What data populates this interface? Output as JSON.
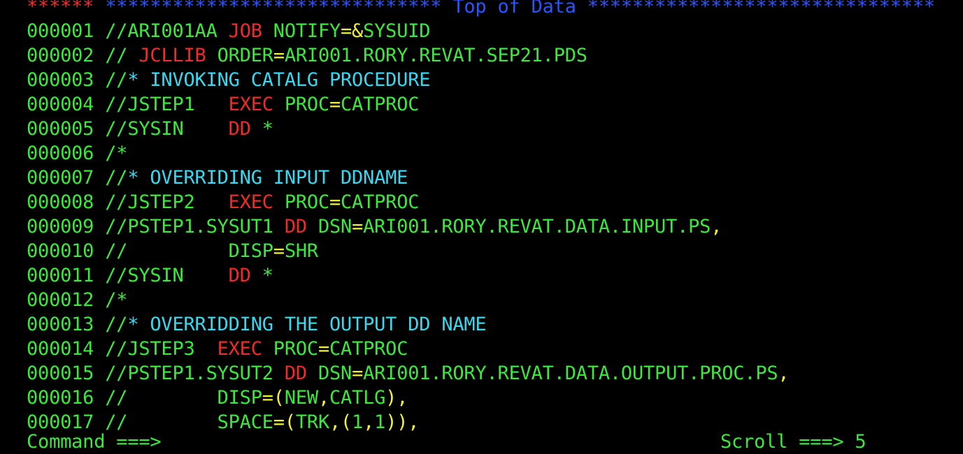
{
  "colors": {
    "green": "#3ce83c",
    "red": "#f22a2a",
    "blue": "#2a54ff",
    "yellow": "#f2f23a",
    "cyan": "#38d8f0"
  },
  "header": {
    "marker": "******",
    "stars_left": " ******************************",
    "title": " Top of Data ",
    "stars_right": "*******************************"
  },
  "lines": [
    {
      "num": "000001",
      "segs": [
        {
          "t": " //ARI001AA ",
          "c": "green"
        },
        {
          "t": "JOB",
          "c": "red"
        },
        {
          "t": " NOTIFY",
          "c": "green"
        },
        {
          "t": "=&",
          "c": "yellow"
        },
        {
          "t": "SYSUID",
          "c": "green"
        }
      ]
    },
    {
      "num": "000002",
      "segs": [
        {
          "t": " // ",
          "c": "green"
        },
        {
          "t": "JCLLIB",
          "c": "red"
        },
        {
          "t": " ORDER",
          "c": "green"
        },
        {
          "t": "=",
          "c": "yellow"
        },
        {
          "t": "ARI001.RORY.REVAT.SEP21.PDS",
          "c": "green"
        }
      ]
    },
    {
      "num": "000003",
      "segs": [
        {
          "t": " //",
          "c": "green"
        },
        {
          "t": "* INVOKING CATALG PROCEDURE",
          "c": "cyan"
        }
      ]
    },
    {
      "num": "000004",
      "segs": [
        {
          "t": " //JSTEP1   ",
          "c": "green"
        },
        {
          "t": "EXEC",
          "c": "red"
        },
        {
          "t": " PROC",
          "c": "green"
        },
        {
          "t": "=",
          "c": "yellow"
        },
        {
          "t": "CATPROC",
          "c": "green"
        }
      ]
    },
    {
      "num": "000005",
      "segs": [
        {
          "t": " //SYSIN    ",
          "c": "green"
        },
        {
          "t": "DD",
          "c": "red"
        },
        {
          "t": " *",
          "c": "green"
        }
      ]
    },
    {
      "num": "000006",
      "segs": [
        {
          "t": " /*",
          "c": "green"
        }
      ]
    },
    {
      "num": "000007",
      "segs": [
        {
          "t": " //",
          "c": "green"
        },
        {
          "t": "* OVERRIDING INPUT DDNAME",
          "c": "cyan"
        }
      ]
    },
    {
      "num": "000008",
      "segs": [
        {
          "t": " //JSTEP2   ",
          "c": "green"
        },
        {
          "t": "EXEC",
          "c": "red"
        },
        {
          "t": " PROC",
          "c": "green"
        },
        {
          "t": "=",
          "c": "yellow"
        },
        {
          "t": "CATPROC",
          "c": "green"
        }
      ]
    },
    {
      "num": "000009",
      "segs": [
        {
          "t": " //PSTEP1.SYSUT1 ",
          "c": "green"
        },
        {
          "t": "DD",
          "c": "red"
        },
        {
          "t": " DSN",
          "c": "green"
        },
        {
          "t": "=",
          "c": "yellow"
        },
        {
          "t": "ARI001.RORY.REVAT.DATA.INPUT.PS",
          "c": "green"
        },
        {
          "t": ",",
          "c": "yellow"
        }
      ]
    },
    {
      "num": "000010",
      "segs": [
        {
          "t": " //         DISP",
          "c": "green"
        },
        {
          "t": "=",
          "c": "yellow"
        },
        {
          "t": "SHR",
          "c": "green"
        }
      ]
    },
    {
      "num": "000011",
      "segs": [
        {
          "t": " //SYSIN    ",
          "c": "green"
        },
        {
          "t": "DD",
          "c": "red"
        },
        {
          "t": " *",
          "c": "green"
        }
      ]
    },
    {
      "num": "000012",
      "segs": [
        {
          "t": " /*",
          "c": "green"
        }
      ]
    },
    {
      "num": "000013",
      "segs": [
        {
          "t": " //",
          "c": "green"
        },
        {
          "t": "* OVERRIDDING THE OUTPUT DD NAME",
          "c": "cyan"
        }
      ]
    },
    {
      "num": "000014",
      "segs": [
        {
          "t": " //JSTEP3  ",
          "c": "green"
        },
        {
          "t": "EXEC",
          "c": "red"
        },
        {
          "t": " PROC",
          "c": "green"
        },
        {
          "t": "=",
          "c": "yellow"
        },
        {
          "t": "CATPROC",
          "c": "green"
        }
      ]
    },
    {
      "num": "000015",
      "segs": [
        {
          "t": " //PSTEP1.SYSUT2 ",
          "c": "green"
        },
        {
          "t": "DD",
          "c": "red"
        },
        {
          "t": " DSN",
          "c": "green"
        },
        {
          "t": "=",
          "c": "yellow"
        },
        {
          "t": "ARI001.RORY.REVAT.DATA.OUTPUT.PROC.PS",
          "c": "green"
        },
        {
          "t": ",",
          "c": "yellow"
        }
      ]
    },
    {
      "num": "000016",
      "segs": [
        {
          "t": " //        DISP",
          "c": "green"
        },
        {
          "t": "=(",
          "c": "yellow"
        },
        {
          "t": "NEW",
          "c": "green"
        },
        {
          "t": ",",
          "c": "yellow"
        },
        {
          "t": "CATLG",
          "c": "green"
        },
        {
          "t": "),",
          "c": "yellow"
        }
      ]
    },
    {
      "num": "000017",
      "segs": [
        {
          "t": " //        SPACE",
          "c": "green"
        },
        {
          "t": "=(",
          "c": "yellow"
        },
        {
          "t": "TRK",
          "c": "green"
        },
        {
          "t": ",(",
          "c": "yellow"
        },
        {
          "t": "1",
          "c": "green"
        },
        {
          "t": ",",
          "c": "yellow"
        },
        {
          "t": "1",
          "c": "green"
        },
        {
          "t": ")),",
          "c": "yellow"
        }
      ]
    }
  ],
  "command": {
    "label": "Command ===>",
    "value": ""
  },
  "scroll": {
    "label": "Scroll ===>",
    "value": " 5"
  }
}
